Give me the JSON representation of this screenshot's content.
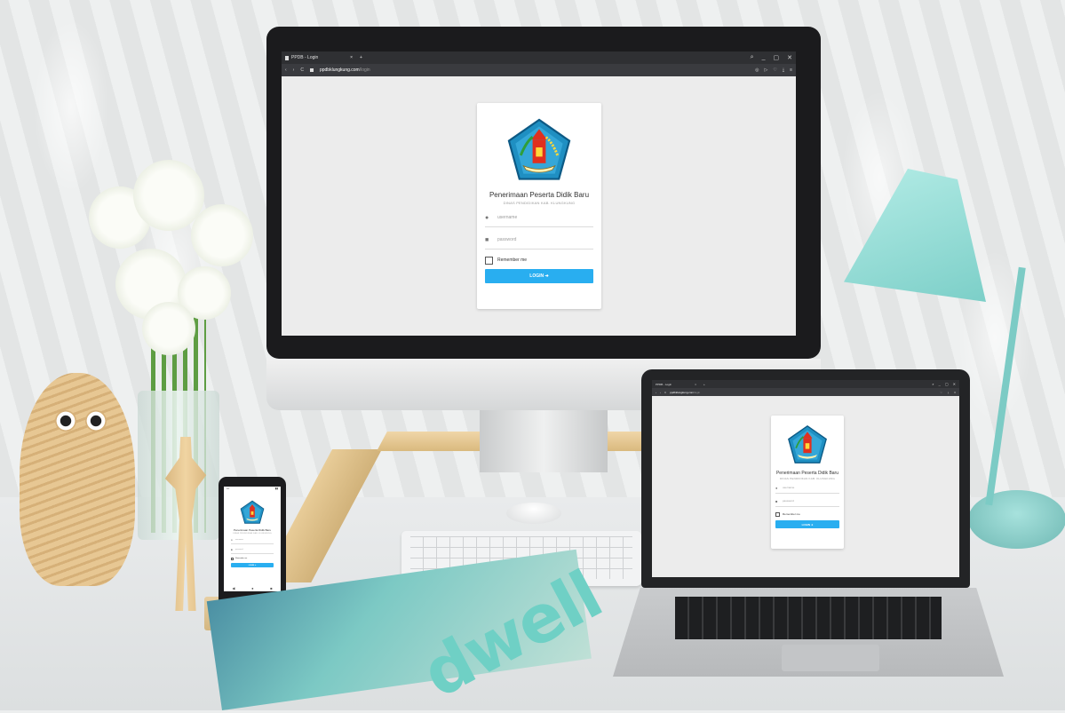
{
  "browser": {
    "tab_title": "PPDB - Login",
    "tab_close": "×",
    "new_tab": "+",
    "nav_back": "‹",
    "nav_forward": "›",
    "reload": "C",
    "url_domain": "ppdbklungkung.com",
    "url_path": "/login",
    "win_controls": [
      "⌕",
      "_",
      "▢",
      "✕"
    ]
  },
  "login": {
    "title": "Penerimaan Peserta Didik Baru",
    "subtitle": "DINAS PENDIDIKAN KAB. KLUNGKUNG",
    "username_placeholder": "username",
    "password_placeholder": "password",
    "remember_label": "Remember me",
    "login_button": "LOGIN ➔"
  },
  "magazine": {
    "title": "dwell"
  },
  "colors": {
    "accent": "#29aef0",
    "browser_chrome": "#2f3033",
    "page_bg": "#ececec"
  }
}
